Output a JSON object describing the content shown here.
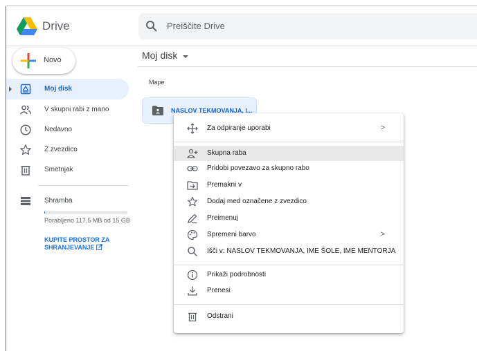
{
  "app": {
    "name": "Drive"
  },
  "search": {
    "placeholder": "Preiščite Drive"
  },
  "sidebar": {
    "new_label": "Novo",
    "items": [
      {
        "label": "Moj disk",
        "icon": "my-drive-icon",
        "active": true
      },
      {
        "label": "V skupni rabi z mano",
        "icon": "shared-icon"
      },
      {
        "label": "Nedavno",
        "icon": "clock-icon"
      },
      {
        "label": "Z zvezdico",
        "icon": "star-icon"
      },
      {
        "label": "Smetnjak",
        "icon": "trash-icon"
      }
    ],
    "storage": {
      "label": "Shramba",
      "usage_text": "Porabljeno 117,5 MB od 15 GB",
      "used_fraction": 0.0078,
      "buy_link": "KUPITE PROSTOR ZA SHRANJEVANJE"
    }
  },
  "main": {
    "breadcrumb": "Moj disk",
    "section_label": "Mape",
    "folder_name": "NASLOV TEKMOVANJA, I..."
  },
  "context_menu": {
    "items": [
      {
        "label": "Za odpiranje uporabi",
        "icon": "open-with-icon",
        "submenu": true
      },
      {
        "label": "Skupna raba",
        "icon": "share-person-icon",
        "highlighted": true
      },
      {
        "label": "Pridobi povezavo za skupno rabo",
        "icon": "link-icon"
      },
      {
        "label": "Premakni v",
        "icon": "move-folder-icon"
      },
      {
        "label": "Dodaj med označene z zvezdico",
        "icon": "star-icon"
      },
      {
        "label": "Preimenuj",
        "icon": "pencil-icon"
      },
      {
        "label": "Spremeni barvo",
        "icon": "palette-icon",
        "submenu": true
      },
      {
        "label": "Išči v: NASLOV TEKMOVANJA, IME ŠOLE, IME MENTORJA",
        "icon": "search-icon"
      },
      {
        "label": "Prikaži podrobnosti",
        "icon": "info-icon"
      },
      {
        "label": "Prenesi",
        "icon": "download-icon"
      },
      {
        "label": "Odstrani",
        "icon": "trash-icon"
      }
    ],
    "submenu_arrow": ">"
  },
  "colors": {
    "accent": "#1a73e8",
    "active_bg": "#e8f0fe",
    "active_text": "#1967d2"
  }
}
